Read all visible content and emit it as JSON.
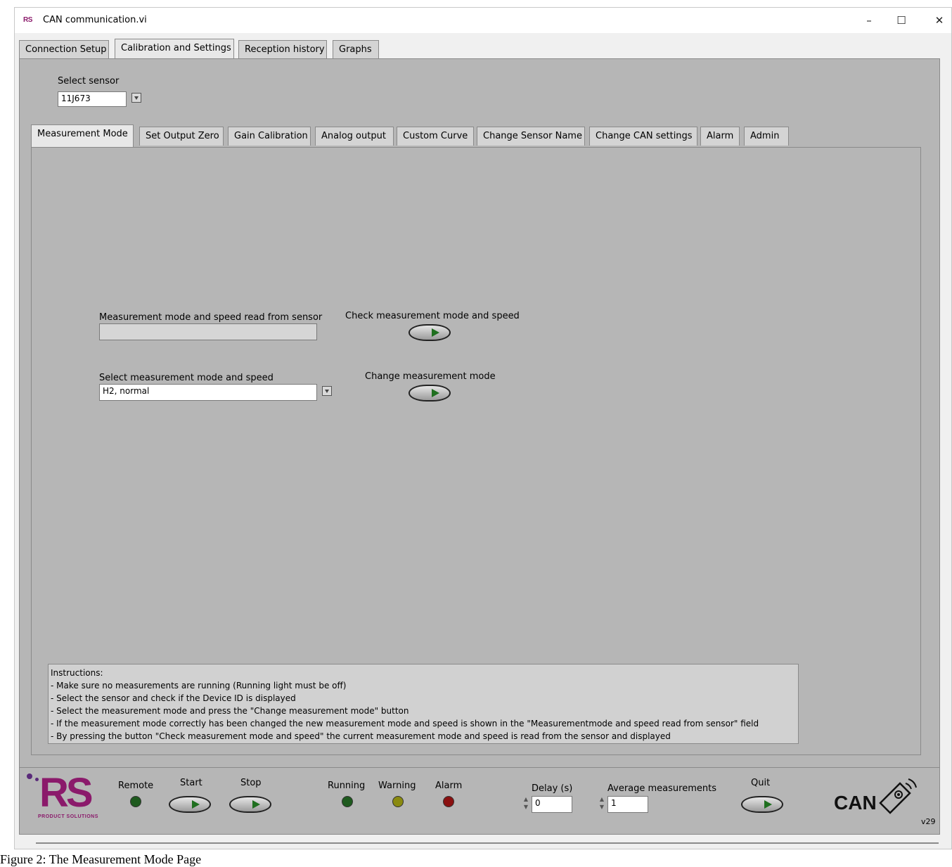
{
  "window": {
    "title": "CAN communication.vi",
    "app_icon_text": "RS",
    "minimize": "–",
    "maximize": "☐",
    "close": "✕"
  },
  "top_tabs": [
    "Connection Setup",
    "Calibration and Settings",
    "Reception history",
    "Graphs"
  ],
  "active_top_tab": "Calibration and Settings",
  "sensor": {
    "label": "Select sensor",
    "value": "11J673"
  },
  "inner_tabs": [
    "Measurement Mode",
    "Set Output Zero",
    "Gain Calibration",
    "Analog output",
    "Custom Curve",
    "Change Sensor Name",
    "Change CAN settings",
    "Alarm",
    "Admin"
  ],
  "active_inner_tab": "Measurement Mode",
  "measurement": {
    "read_label": "Measurement mode and speed read from sensor",
    "read_value": "",
    "check_label": "Check measurement mode and speed",
    "select_label": "Select measurement mode and speed",
    "select_value": "H2, normal",
    "change_label": "Change measurement mode"
  },
  "instructions": [
    "Instructions:",
    "- Make sure no measurements are running (Running light must be off)",
    "- Select the sensor and check if the Device ID is displayed",
    "- Select the measurement mode and press the \"Change measurement mode\" button",
    "- If the measurement mode correctly has been changed the new measurement mode and speed is shown in the \"Measurementmode and speed read from sensor\" field",
    "- By pressing the button \"Check measurement mode and speed\" the current measurement mode and speed is read from the sensor and displayed"
  ],
  "bottom": {
    "logo_text": "RS",
    "logo_sub": "PRODUCT SOLUTIONS",
    "remote_label": "Remote",
    "start_label": "Start",
    "stop_label": "Stop",
    "running_label": "Running",
    "warning_label": "Warning",
    "alarm_label": "Alarm",
    "delay_label": "Delay (s)",
    "delay_value": "0",
    "average_label": "Average measurements",
    "average_value": "1",
    "quit_label": "Quit",
    "can_logo": "CAN",
    "version": "v29"
  },
  "colors": {
    "remote_led": "#1e5a1e",
    "running_led": "#1e5a1e",
    "warning_led": "#8a8a10",
    "alarm_led": "#8a1010",
    "logo_accent": "#8b1a6b"
  },
  "caption": "Figure 2: The Measurement Mode Page"
}
